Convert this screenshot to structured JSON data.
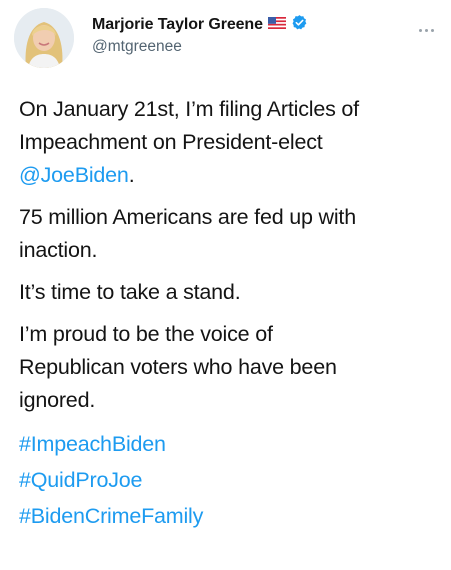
{
  "user": {
    "display_name": "Marjorie Taylor Greene",
    "handle": "@mtgreenee"
  },
  "icons": {
    "flag": "us-flag-icon",
    "verified": "verified-badge-icon",
    "more": "more-options-icon"
  },
  "colors": {
    "link": "#1d9bf0",
    "verified": "#1d9bf0",
    "text": "#141414",
    "muted": "#536471"
  },
  "tweet": {
    "p1_line1": "On January 21st, I’m filing Articles of",
    "p1_line2": "Impeachment on President-elect",
    "p1_mention": "@JoeBiden",
    "p1_end": ".",
    "p2_line1": "75 million Americans are fed up with",
    "p2_line2": "inaction.",
    "p3": "It’s time to take a stand.",
    "p4_line1": "I’m proud to be the voice of",
    "p4_line2": "Republican voters who have been",
    "p4_line3": "ignored.",
    "hashtags": [
      "#ImpeachBiden",
      "#QuidProJoe",
      "#BidenCrimeFamily"
    ]
  }
}
